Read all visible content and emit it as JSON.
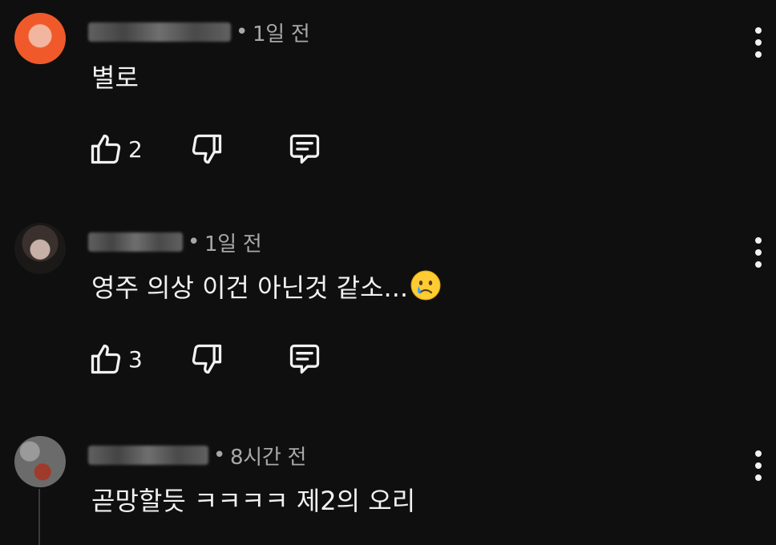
{
  "comments": [
    {
      "time_sep": "•",
      "time": "1일 전",
      "text": "별로",
      "likes": "2",
      "author_blurred": true
    },
    {
      "time_sep": "•",
      "time": "1일 전",
      "text": "영주 의상 이건 아닌것 같소...",
      "emoji": "crying-face",
      "likes": "3",
      "author_blurred": true
    },
    {
      "time_sep": "•",
      "time": "8시간 전",
      "text": "곧망할듯 ㅋㅋㅋㅋ 제2의 오리",
      "author_blurred": true
    }
  ],
  "icons": {
    "like": "thumbs-up-icon",
    "dislike": "thumbs-down-icon",
    "reply": "reply-comment-icon",
    "more": "more-vertical-icon"
  },
  "colors": {
    "background": "#0f0f0f",
    "text": "#f1f1f1",
    "meta": "#a8a8a8"
  }
}
